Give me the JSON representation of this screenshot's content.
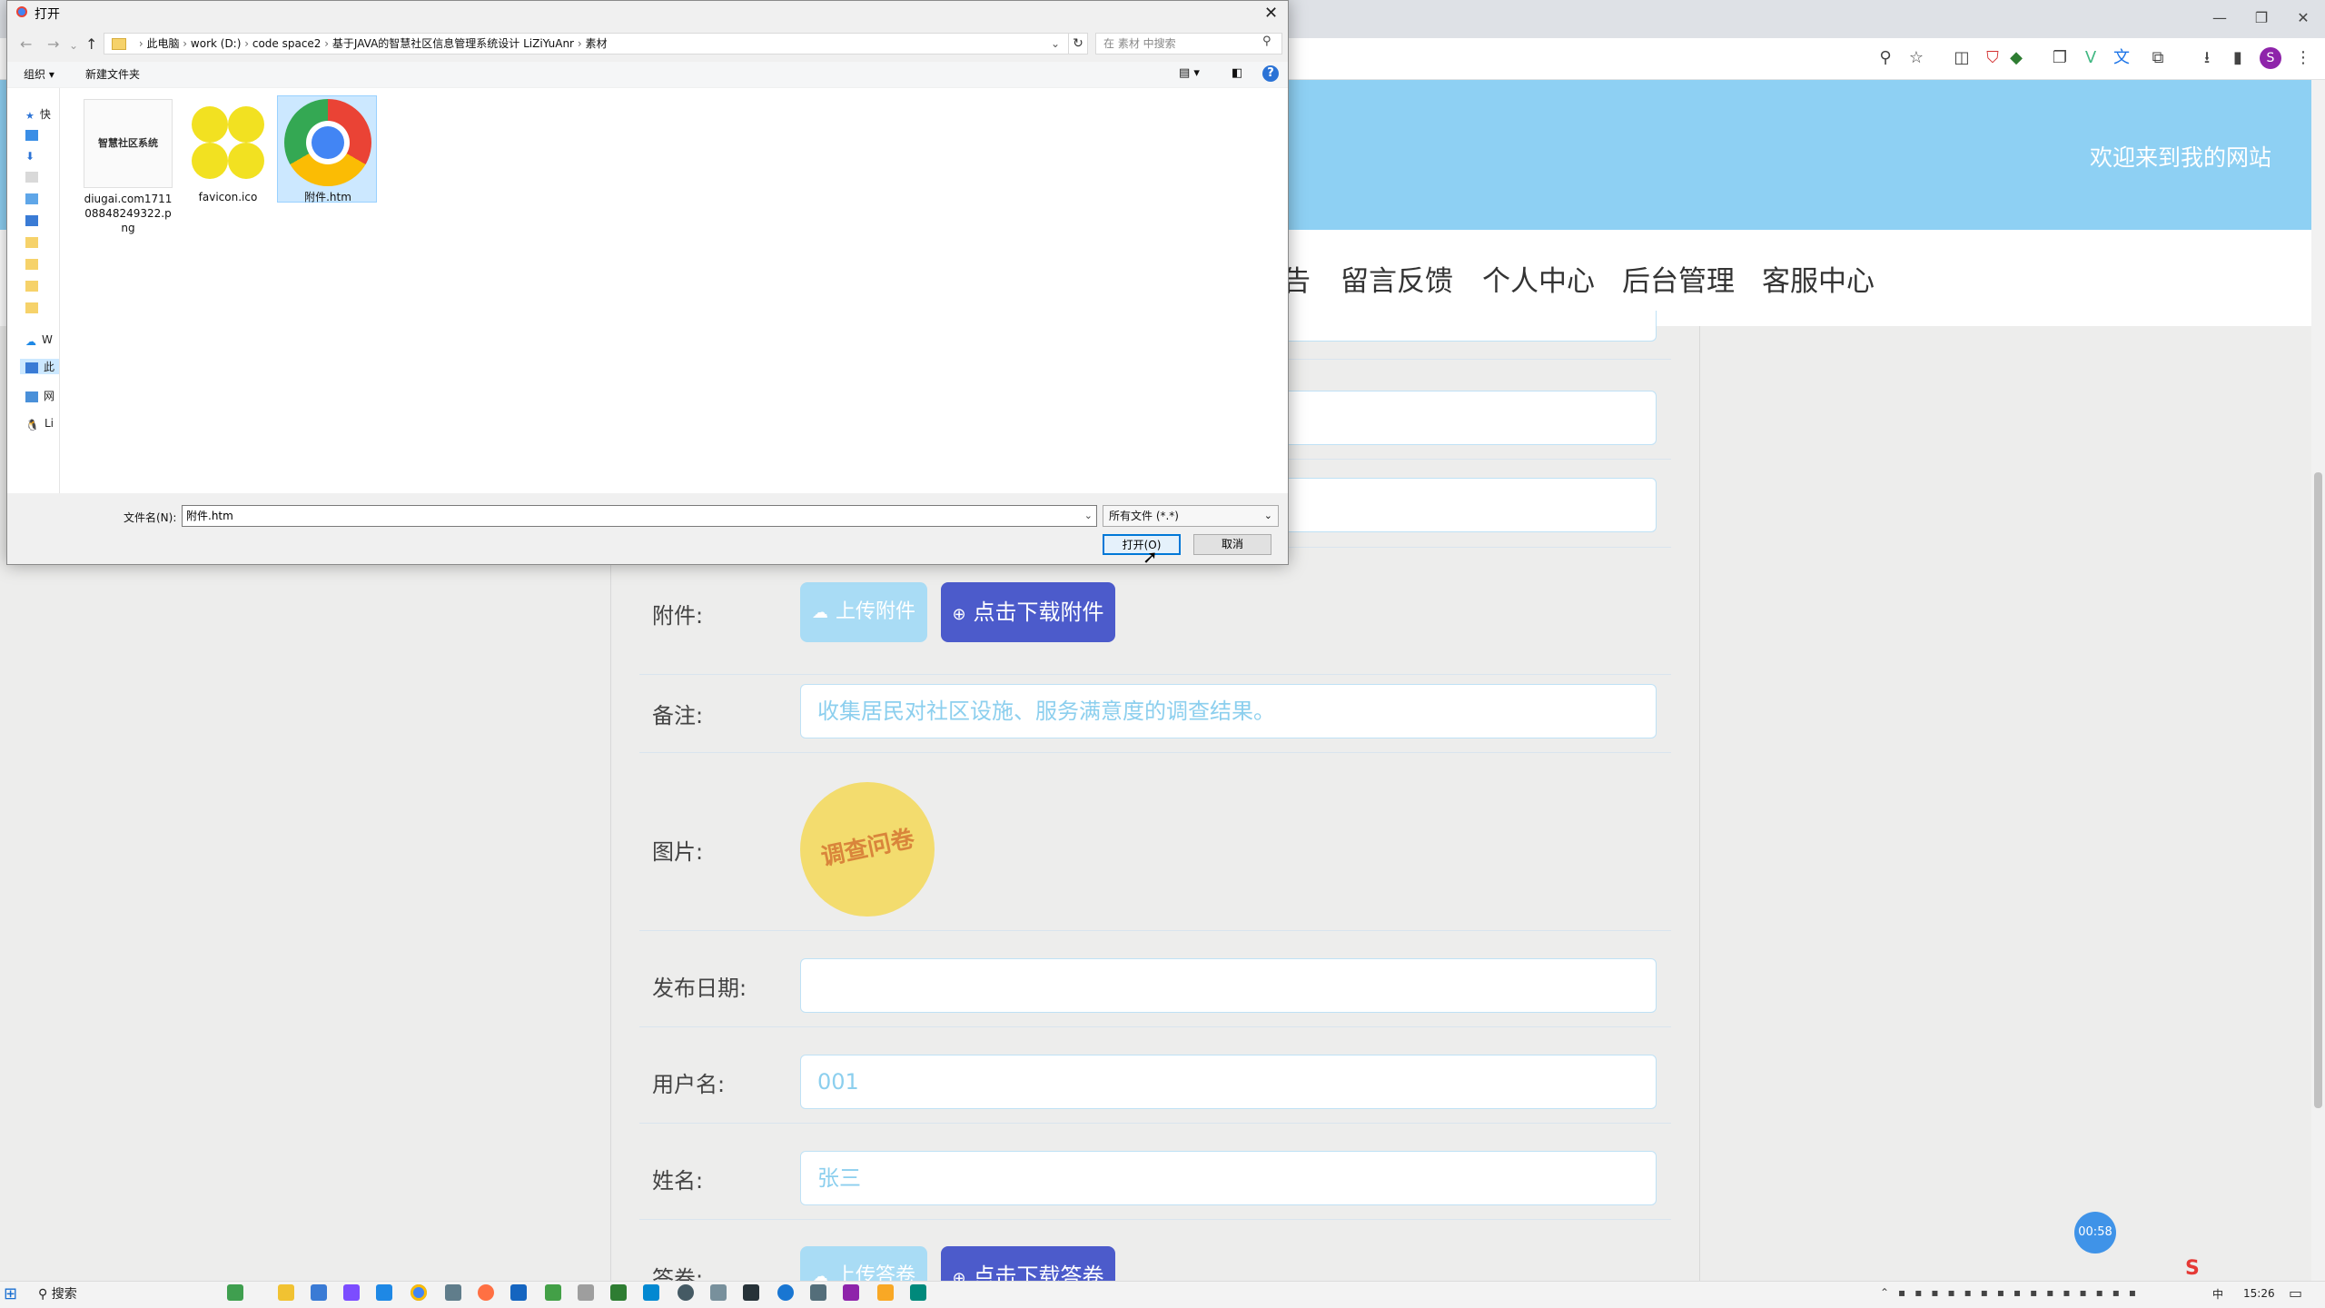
{
  "browser": {
    "window_controls": [
      "—",
      "❐",
      "✕"
    ],
    "toolbar_icons": [
      "zoom-icon",
      "star-icon",
      "screenshot-icon",
      "shield-icon",
      "extension-icon",
      "copy-icon",
      "vue-icon",
      "translate-icon",
      "puzzle-icon",
      "download-icon",
      "sidebar-icon"
    ],
    "profile_initial": "S",
    "menu_glyph": "⋮"
  },
  "site": {
    "welcome": "欢迎来到我的网站",
    "nav": [
      "告",
      "留言反馈",
      "个人中心",
      "后台管理",
      "客服中心"
    ]
  },
  "form": {
    "attachment_label": "附件:",
    "upload_attachment": "上传附件",
    "download_attachment": "点击下载附件",
    "remark_label": "备注:",
    "remark_value": "收集居民对社区设施、服务满意度的调查结果。",
    "image_label": "图片:",
    "image_caption": "调查问卷",
    "publish_date_label": "发布日期:",
    "publish_date_value": "",
    "username_label": "用户名:",
    "username_value": "001",
    "name_label": "姓名:",
    "name_value": "张三",
    "answer_label": "答卷:",
    "upload_answer": "上传答卷",
    "download_answer": "点击下载答卷"
  },
  "timer": "00:58",
  "dialog": {
    "title": "打开",
    "close": "✕",
    "path": [
      "此电脑",
      "work (D:)",
      "code space2",
      "基于JAVA的智慧社区信息管理系统设计 LiZiYuAnr",
      "素材"
    ],
    "search_placeholder": "在 素材 中搜索",
    "organize": "组织 ▾",
    "new_folder": "新建文件夹",
    "help": "?",
    "nav_pane": [
      "快",
      "",
      "",
      "",
      "",
      "",
      "",
      "",
      "",
      "W",
      "此",
      "网",
      "Li"
    ],
    "files": [
      {
        "name": "diugai.com1711 08848249322.p ng",
        "thumb_text": "智慧社区系统"
      },
      {
        "name": "favicon.ico"
      },
      {
        "name": "附件.htm"
      }
    ],
    "filename_label": "文件名(N):",
    "filename_value": "附件.htm",
    "filetype": "所有文件 (*.*)",
    "open_button": "打开(O)",
    "cancel_button": "取消"
  },
  "taskbar": {
    "search": "搜索",
    "tray_ime": "中",
    "time": "15:26",
    "ime_logo": "S"
  }
}
